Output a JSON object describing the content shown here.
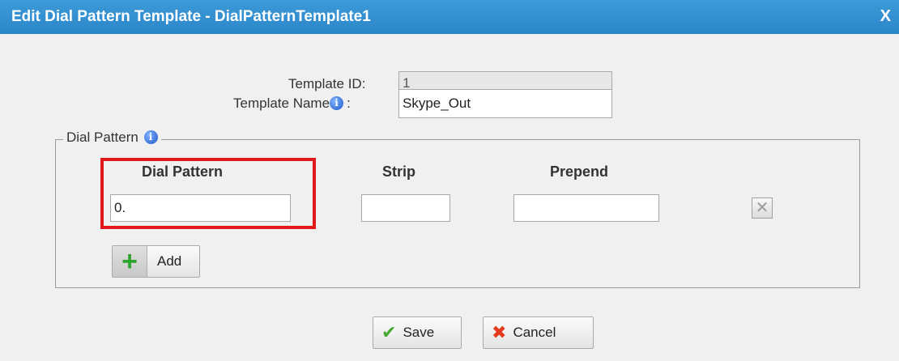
{
  "dialog": {
    "title": "Edit Dial Pattern Template - DialPatternTemplate1",
    "close_label": "X"
  },
  "form": {
    "template_id_label": "Template ID:",
    "template_id_value": "1",
    "template_name_label": "Template Name",
    "template_name_colon": ":",
    "template_name_value": "Skype_Out"
  },
  "dial_pattern_group": {
    "legend": "Dial Pattern",
    "columns": [
      "Dial Pattern",
      "Strip",
      "Prepend"
    ],
    "rows": [
      {
        "dial_pattern": "0.",
        "strip": "",
        "prepend": ""
      }
    ],
    "add_label": "Add"
  },
  "footer": {
    "save_label": "Save",
    "cancel_label": "Cancel"
  },
  "icons": {
    "info": "info-icon",
    "delete": "delete-icon",
    "add": "plus-icon",
    "save": "checkmark-icon",
    "cancel": "x-icon"
  },
  "colors": {
    "titlebar": "#2b86c8",
    "highlight": "#e0191c"
  }
}
